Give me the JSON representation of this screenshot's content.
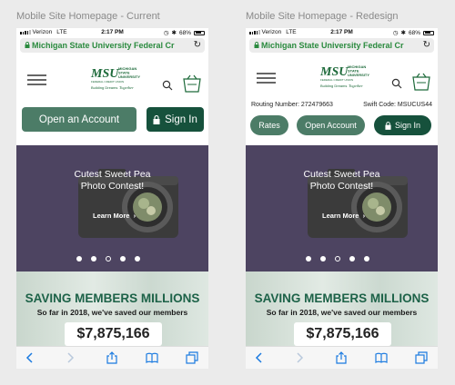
{
  "artboards": {
    "left_title": "Mobile Site Homepage - Current",
    "right_title": "Mobile Site Homepage - Redesign"
  },
  "status_bar": {
    "carrier": "Verizon",
    "network": "LTE",
    "time": "2:17 PM",
    "battery": "68%"
  },
  "browser": {
    "url": "Michigan State University Federal Cr"
  },
  "logo": {
    "wordmark": "MSU",
    "name_lines": [
      "MICHIGAN",
      "STATE",
      "UNIVERSITY"
    ],
    "sub": "FEDERAL CREDIT UNION",
    "tagline": "Building Dreams Together"
  },
  "current": {
    "open_account": "Open an Account",
    "sign_in": "Sign In"
  },
  "redesign": {
    "routing": "Routing Number: 272479663",
    "swift": "Swift Code: MSUCUS44",
    "rates": "Rates",
    "open_account": "Open Account",
    "sign_in": "Sign In"
  },
  "hero": {
    "line1": "Cutest Sweet Pea",
    "line2": "Photo Contest!",
    "learn_more": "Learn More",
    "slide_count": 5,
    "active_slide": 3
  },
  "savings": {
    "headline": "SAVING MEMBERS MILLIONS",
    "subline": "So far in 2018, we've saved our members",
    "amount": "$7,875,166"
  },
  "colors": {
    "primary_green": "#4c7c67",
    "dark_green": "#16513c",
    "hero_purple": "#4d4461",
    "url_green": "#2a8a3e"
  },
  "icons": [
    "lock-icon",
    "reload-icon",
    "hamburger-icon",
    "search-icon",
    "cart-icon",
    "camera-icon",
    "chevron-right-icon",
    "back-icon",
    "forward-icon",
    "share-icon",
    "bookmarks-icon",
    "tabs-icon"
  ]
}
